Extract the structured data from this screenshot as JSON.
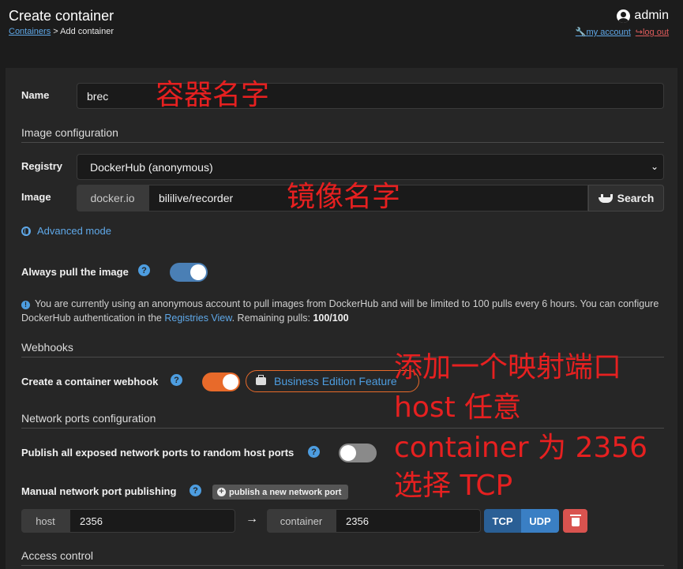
{
  "header": {
    "title": "Create container",
    "breadcrumb_link": "Containers",
    "breadcrumb_current": "> Add container",
    "username": "admin",
    "my_account": "my account",
    "logout": "log out"
  },
  "form": {
    "name_label": "Name",
    "name_value": "brec",
    "image_section": "Image configuration",
    "registry_label": "Registry",
    "registry_value": "DockerHub (anonymous)",
    "image_label": "Image",
    "image_prefix": "docker.io",
    "image_value": "bililive/recorder",
    "search_label": "Search",
    "advanced_mode": "Advanced mode",
    "always_pull_label": "Always pull the image",
    "always_pull_on": true,
    "info_text_1": "You are currently using an anonymous account to pull images from DockerHub and will be limited to 100 pulls every 6 hours. You can configure DockerHub authentication in the ",
    "info_link": "Registries View",
    "info_text_2": ". Remaining pulls: ",
    "info_pulls": "100/100",
    "webhooks_section": "Webhooks",
    "webhook_label": "Create a container webhook",
    "webhook_on": true,
    "business_badge": "Business Edition Feature",
    "network_section": "Network ports configuration",
    "publish_all_label": "Publish all exposed network ports to random host ports",
    "publish_all_on": false,
    "manual_label": "Manual network port publishing",
    "publish_new_button": "publish a new network port",
    "port_host_label": "host",
    "port_host_value": "2356",
    "port_arrow": "→",
    "port_container_label": "container",
    "port_container_value": "2356",
    "proto_tcp": "TCP",
    "proto_udp": "UDP",
    "access_section": "Access control"
  },
  "annotations": {
    "name_note": "容器名字",
    "image_note": "镜像名字",
    "port_note_1": "添加一个映射端口",
    "port_note_2": "host 任意",
    "port_note_3": "container 为 2356",
    "port_note_4": "选择 TCP"
  },
  "colors": {
    "accent": "#4d9de0",
    "annotation": "#e62020",
    "toggle_on": "#4a7fb5",
    "business_toggle": "#e86a2a",
    "danger": "#d9534f"
  }
}
